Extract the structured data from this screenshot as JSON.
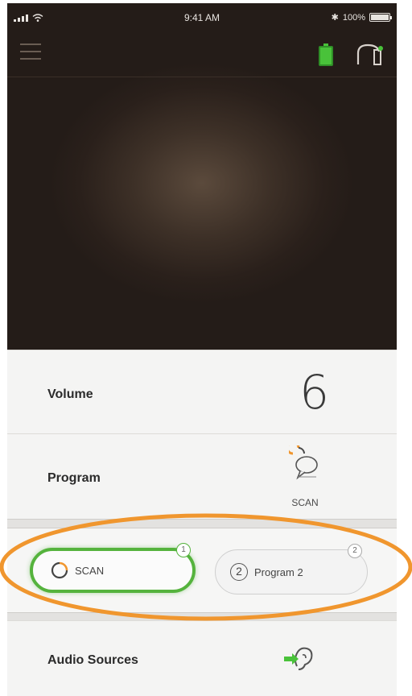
{
  "status_bar": {
    "time": "9:41 AM",
    "battery": "100%",
    "bluetooth": "✱"
  },
  "volume": {
    "label": "Volume",
    "value": "6"
  },
  "program": {
    "label": "Program",
    "current": "SCAN"
  },
  "program_buttons": [
    {
      "label": "SCAN",
      "slot": "1",
      "selected": true
    },
    {
      "label": "Program 2",
      "number": "2",
      "slot": "2",
      "selected": false
    }
  ],
  "audio_sources": {
    "label": "Audio Sources"
  },
  "colors": {
    "accent_green": "#55b33d",
    "highlight_orange": "#f0962e",
    "header_dark": "#2a201b"
  },
  "icons": {
    "menu": "hamburger-icon",
    "device_battery": "battery-icon",
    "hearing_aid": "hearing-aid-icon",
    "program": "speech-bubble-icon",
    "scan": "scan-ring-icon",
    "audio": "ear-stream-icon"
  }
}
